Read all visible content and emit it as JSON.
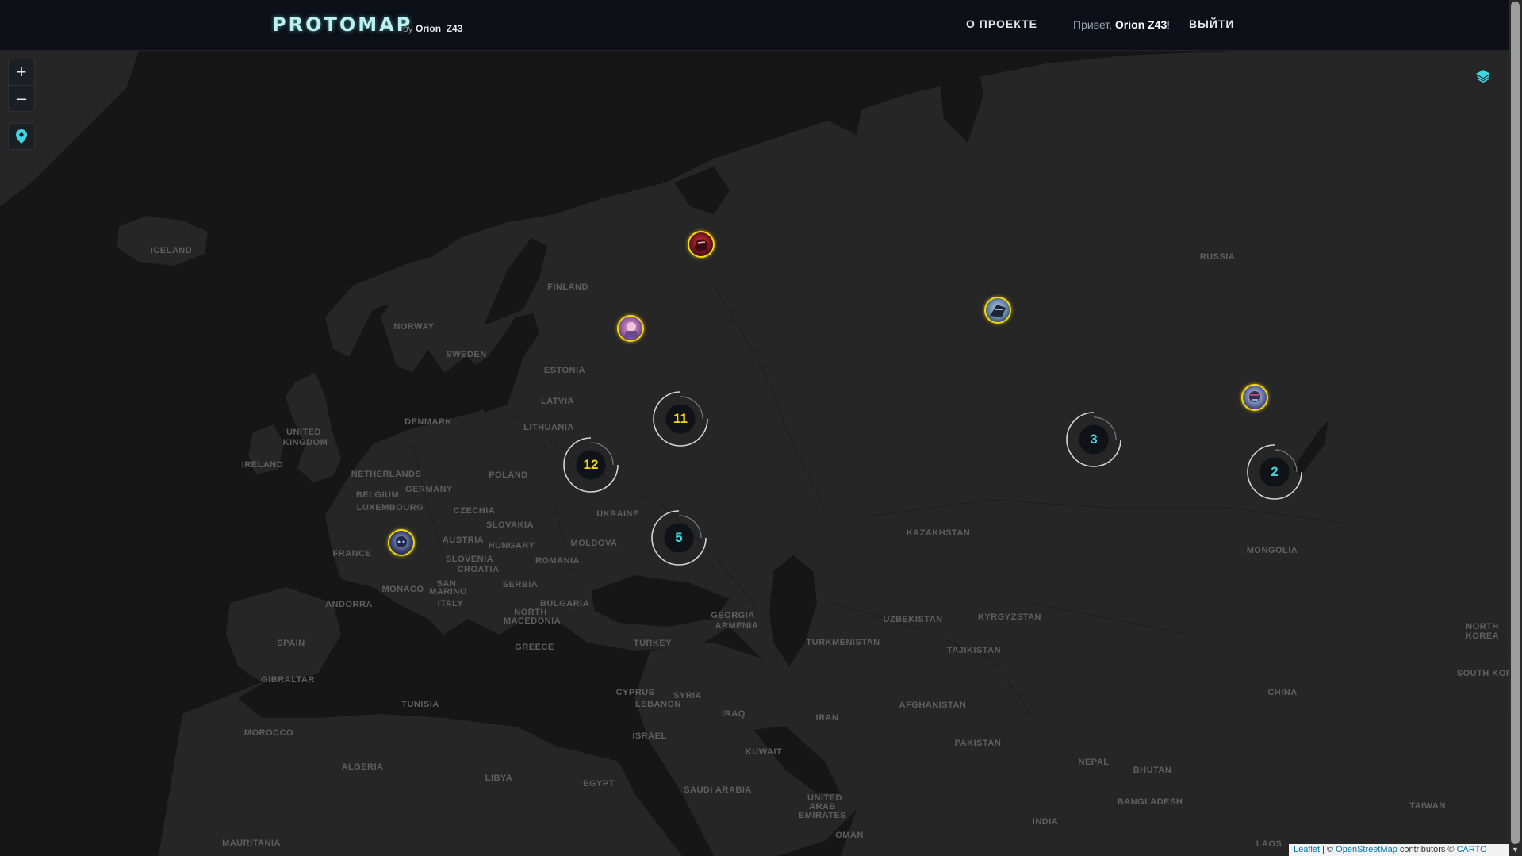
{
  "header": {
    "logo": "PROTOMAP",
    "by_prefix": "by",
    "author": "Orion_Z43",
    "nav_about": "О ПРОЕКТЕ",
    "greeting_prefix": "Привет,",
    "greeting_name": "Orion Z43",
    "greeting_suffix": "!",
    "logout": "ВЫЙТИ"
  },
  "controls": {
    "zoom_in": "+",
    "zoom_out": "–"
  },
  "colors": {
    "accent": "#3fd6e0",
    "avatar_ring": "#f5d90a",
    "cluster_yellow": "#f5d90a",
    "cluster_cyan": "#3fd6e0",
    "background": "#161616"
  },
  "map_labels": {
    "iceland": "ICELAND",
    "finland": "FINLAND",
    "norway": "NORWAY",
    "sweden": "SWEDEN",
    "estonia": "ESTONIA",
    "latvia": "LATVIA",
    "lithuania": "LITHUANIA",
    "denmark": "DENMARK",
    "united": "UNITED",
    "kingdom": "KINGDOM",
    "ireland": "IRELAND",
    "netherlands": "NETHERLANDS",
    "belgium": "BELGIUM",
    "luxembourg": "LUXEMBOURG",
    "germany": "GERMANY",
    "poland": "POLAND",
    "czechia": "CZECHIA",
    "slovakia": "SLOVAKIA",
    "ukraine": "UKRAINE",
    "moldova": "MOLDOVA",
    "austria": "AUSTRIA",
    "hungary": "HUNGARY",
    "romania": "ROMANIA",
    "slovenia": "SLOVENIA",
    "croatia": "CROATIA",
    "france": "FRANCE",
    "monaco": "MONACO",
    "san": "SAN",
    "marino": "MARINO",
    "serbia": "SERBIA",
    "bulgaria": "BULGARIA",
    "north": "NORTH",
    "macedonia": "MACEDONIA",
    "andorra": "ANDORRA",
    "italy": "ITALY",
    "spain": "SPAIN",
    "greece": "GREECE",
    "turkey": "TURKEY",
    "georgia": "GEORGIA",
    "armenia": "ARMENIA",
    "gibraltar": "GIBRALTAR",
    "tunisia": "TUNISIA",
    "cyprus": "CYPRUS",
    "syria": "SYRIA",
    "lebanon": "LEBANON",
    "iraq": "IRAQ",
    "iran": "IRAN",
    "israel": "ISRAEL",
    "morocco": "MOROCCO",
    "algeria": "ALGERIA",
    "libya": "LIBYA",
    "egypt": "EGYPT",
    "kuwait": "KUWAIT",
    "saudi_arabia": "SAUDI ARABIA",
    "united2": "UNITED",
    "arab": "ARAB",
    "emirates": "EMIRATES",
    "oman": "OMAN",
    "mauritania": "MAURITANIA",
    "russia": "RUSSIA",
    "kazakhstan": "KAZAKHSTAN",
    "uzbekistan": "UZBEKISTAN",
    "kyrgyzstan": "KYRGYZSTAN",
    "turkmenistan": "TURKMENISTAN",
    "tajikistan": "TAJIKISTAN",
    "afghanistan": "AFGHANISTAN",
    "pakistan": "PAKISTAN",
    "mongolia": "MONGOLIA",
    "china": "CHINA",
    "nepal": "NEPAL",
    "bhutan": "BHUTAN",
    "bangladesh": "BANGLADESH",
    "india": "INDIA",
    "north_korea_1": "NORTH",
    "north_korea_2": "KOREA",
    "south_korea": "SOUTH KOR",
    "taiwan": "TAIWAN",
    "laos": "LAOS"
  },
  "clusters": [
    {
      "count": "11",
      "color": "yellow"
    },
    {
      "count": "12",
      "color": "yellow"
    },
    {
      "count": "5",
      "color": "cyan"
    },
    {
      "count": "3",
      "color": "cyan"
    },
    {
      "count": "2",
      "color": "cyan"
    }
  ],
  "attribution": {
    "leaflet": "Leaflet",
    "sep1": " | © ",
    "osm": "OpenStreetMap",
    "mid": " contributors © ",
    "carto": "CARTO"
  }
}
